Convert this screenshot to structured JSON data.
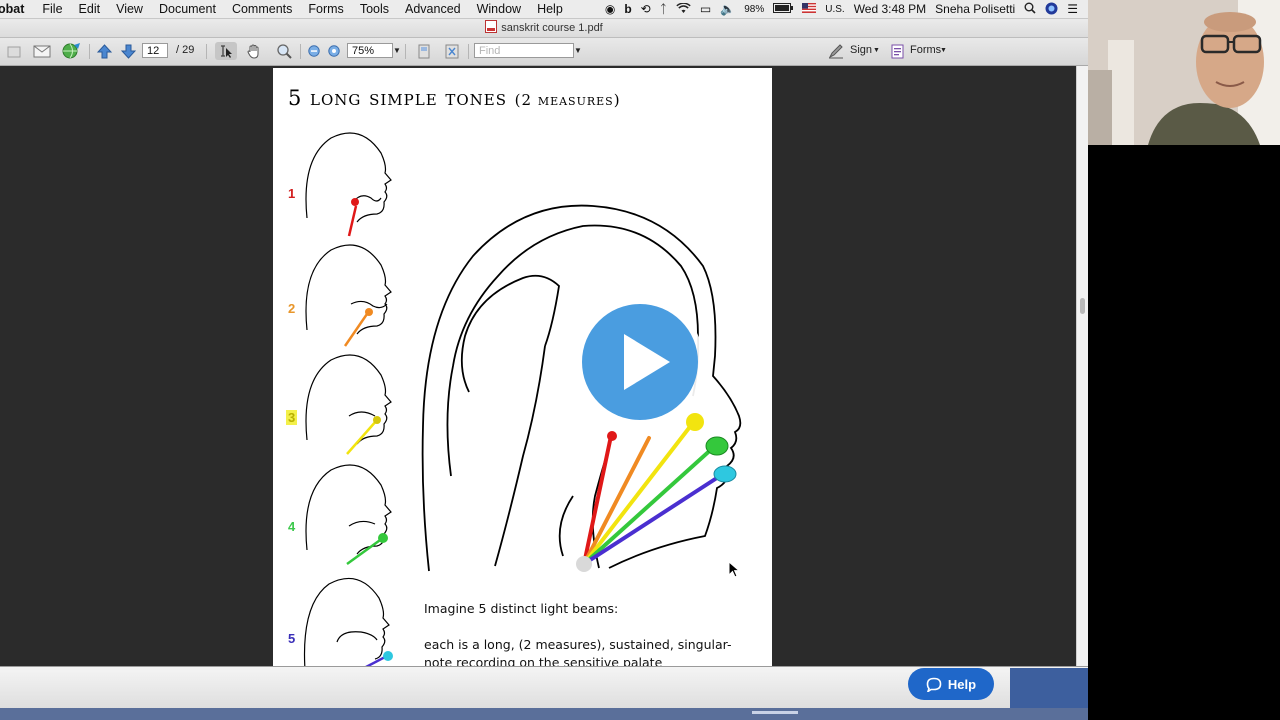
{
  "menubar": {
    "app": "obat",
    "menus": [
      "File",
      "Edit",
      "View",
      "Document",
      "Comments",
      "Forms",
      "Tools",
      "Advanced",
      "Window",
      "Help"
    ],
    "battery": "98%",
    "input_source": "U.S.",
    "clock": "Wed 3:48 PM",
    "user": "Sneha Polisetti"
  },
  "window": {
    "title": "sanskrit course 1.pdf"
  },
  "toolbar": {
    "page_current": "12",
    "page_total": "/ 29",
    "zoom": "75%",
    "find_placeholder": "Find",
    "sign_label": "Sign",
    "forms_label": "Forms"
  },
  "document": {
    "heading_main": "5 long simple tones",
    "heading_sub": "(2 measures)",
    "numbers": [
      "1",
      "2",
      "3",
      "4",
      "5"
    ],
    "number_colors": [
      "#d21e1e",
      "#e8962a",
      "#b8b000",
      "#3cc84b",
      "#3a2fb8"
    ],
    "paragraph1": "Imagine 5 distinct light beams:",
    "paragraph2": "each is a long, (2 measures), sustained, singular-note recording on the sensitive palate"
  },
  "beam_colors": [
    "#e01818",
    "#f08a22",
    "#f2e40f",
    "#34c83c",
    "#4a2fd0"
  ],
  "help_button": {
    "label": "Help"
  },
  "video": {
    "play_icon": "play-icon"
  }
}
